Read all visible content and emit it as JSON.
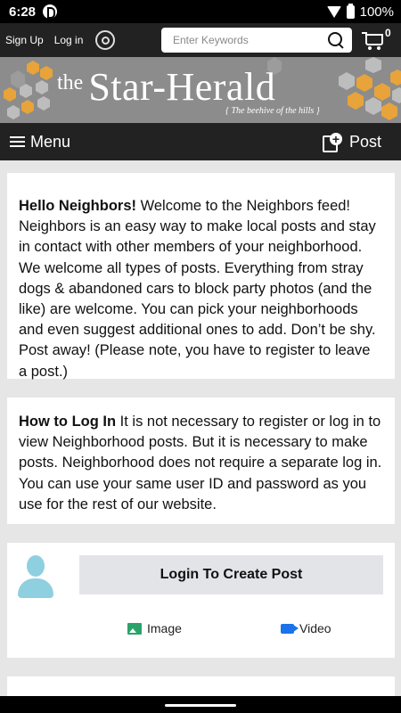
{
  "status_bar": {
    "time": "6:28",
    "battery": "100%"
  },
  "topnav": {
    "sign_up": "Sign Up",
    "log_in": "Log in",
    "search_placeholder": "Enter Keywords",
    "cart_count": "0"
  },
  "banner": {
    "the": "the",
    "name": "Star-Herald",
    "tagline": "{ The beehive of the hills }",
    "accent_color": "#e8a33a"
  },
  "menubar": {
    "menu_label": "Menu",
    "post_label": "Post"
  },
  "cards": {
    "welcome": {
      "heading": "Hello Neighbors!",
      "body": " Welcome to the Neighbors feed! Neighbors is an easy way to make local posts and stay in contact with other members of your neighborhood. We welcome all types of posts. Everything from stray dogs & abandoned cars to block party photos (and the like) are welcome. You can pick your neighborhoods and even suggest additional ones to add. Don’t be shy. Post away! (Please note, you have to register to leave a post.)"
    },
    "login_info": {
      "heading": "How to Log In",
      "body": " It is not necessary to register or log in to view Neighborhood posts. But it is necessary to make posts. Neighborhood does not require a separate log in. You can use your same user ID and password as you use for the rest of our website."
    },
    "composer": {
      "login_button": "Login To Create Post",
      "image_label": "Image",
      "video_label": "Video"
    }
  }
}
